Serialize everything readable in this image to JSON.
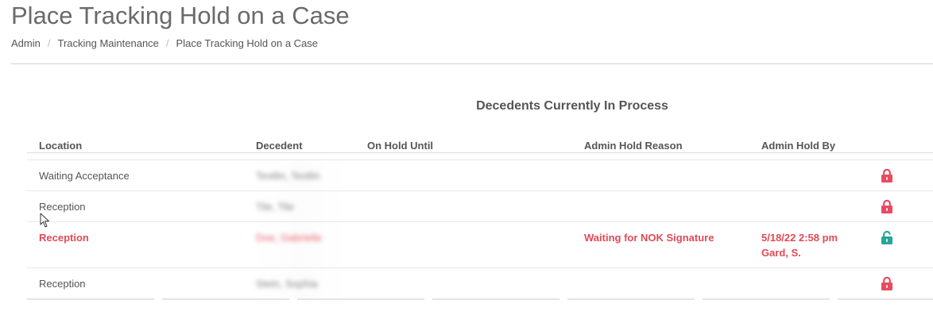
{
  "page": {
    "title": "Place Tracking Hold on a Case"
  },
  "breadcrumb": {
    "items": [
      "Admin",
      "Tracking Maintenance",
      "Place Tracking Hold on a Case"
    ]
  },
  "table": {
    "title": "Decedents Currently In Process",
    "columns": {
      "location": "Location",
      "decedent": "Decedent",
      "on_hold_until": "On Hold Until",
      "reason": "Admin Hold Reason",
      "hold_by": "Admin Hold By"
    },
    "rows": [
      {
        "location": "Waiting Acceptance",
        "decedent": "Testlin, Testlin",
        "on_hold_until": "",
        "reason": "",
        "hold_by_date": "",
        "hold_by_name": "",
        "lock_state": "locked",
        "lock_icon": "lock-icon"
      },
      {
        "location": "Reception",
        "decedent": "Tile, Tile",
        "on_hold_until": "",
        "reason": "",
        "hold_by_date": "",
        "hold_by_name": "",
        "lock_state": "locked",
        "lock_icon": "lock-icon"
      },
      {
        "location": "Reception",
        "decedent": "Doe, Gabrielle",
        "on_hold_until": "",
        "reason": "Waiting for NOK Signature",
        "hold_by_date": "5/18/22 2:58 pm",
        "hold_by_name": "Gard, S.",
        "lock_state": "unlocked",
        "lock_icon": "unlock-icon"
      },
      {
        "location": "Reception",
        "decedent": "Stein, Sophia",
        "on_hold_until": "",
        "reason": "",
        "hold_by_date": "",
        "hold_by_name": "",
        "lock_state": "locked",
        "lock_icon": "lock-icon"
      }
    ]
  },
  "colors": {
    "locked": "#e84a5f",
    "unlocked": "#26a69a",
    "held_text": "#e04a56"
  }
}
